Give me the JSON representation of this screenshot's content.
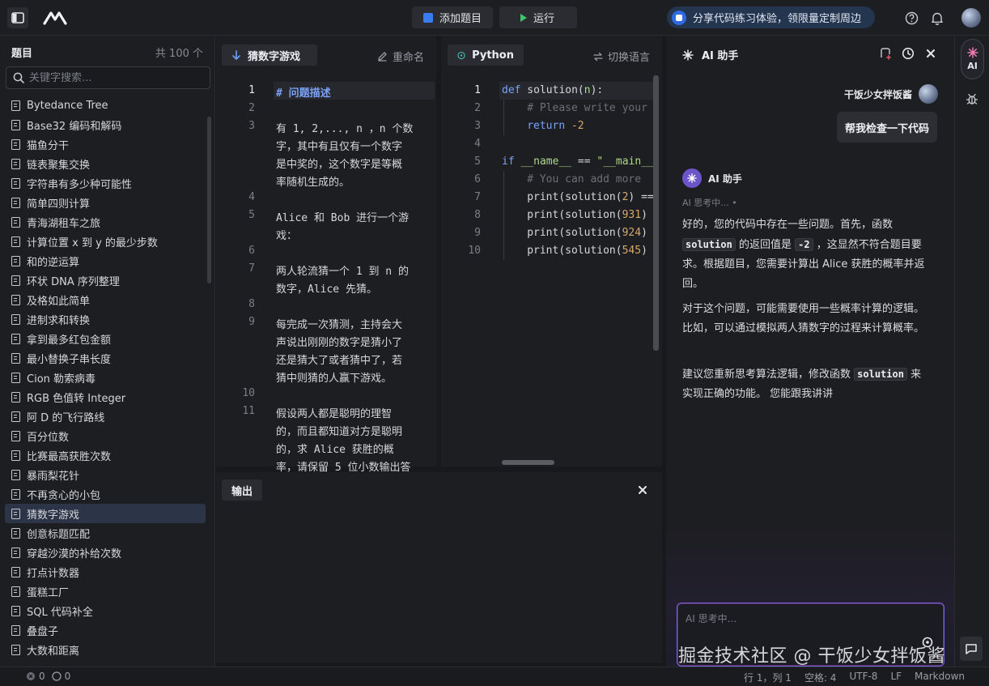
{
  "topbar": {
    "add_problem": "添加题目",
    "run": "运行",
    "share_banner": "分享代码练习体验，领限量定制周边"
  },
  "sidebar": {
    "title": "题目",
    "count": "共 100 个",
    "search_placeholder": "关键字搜索...",
    "items": [
      "Bytedance Tree",
      "Base32 编码和解码",
      "猫鱼分干",
      "链表聚集交换",
      "字符串有多少种可能性",
      "简单四则计算",
      "青海湖租车之旅",
      "计算位置 x 到 y 的最少步数",
      "和的逆运算",
      "环状 DNA 序列整理",
      "及格如此简单",
      "进制求和转换",
      "拿到最多红包金额",
      "最小替换子串长度",
      "Cion 勒索病毒",
      "RGB 色值转 Integer",
      "阿 D 的飞行路线",
      "百分位数",
      "比赛最高获胜次数",
      "暴雨梨花针",
      "不再贪心的小包",
      "猜数字游戏",
      "创意标题匹配",
      "穿越沙漠的补给次数",
      "打点计数器",
      "蛋糕工厂",
      "SQL 代码补全",
      "叠盘子",
      "大数和距离"
    ],
    "active_index": 21
  },
  "problem": {
    "tab": "猜数字游戏",
    "rename": "重命名",
    "line_numbers": [
      "1",
      "2",
      "3",
      "4",
      "5",
      "6",
      "7",
      "8",
      "9",
      "10",
      "11"
    ],
    "lines": [
      "# 问题描述",
      "有 1, 2,..., n ，n 个数",
      "字，其中有且仅有一个数字",
      "是中奖的，这个数字是等概",
      "率随机生成的。",
      "Alice 和 Bob 进行一个游",
      "戏：",
      "两人轮流猜一个 1 到 n 的",
      "数字，Alice 先猜。",
      "每完成一次猜测，主持会大",
      "声说出刚刚的数字是猜小了",
      "还是猜大了或者猜中了，若",
      "猜中则猜的人赢下游戏。",
      "假设两人都是聪明的理智",
      "的，而且都知道对方是聪明",
      "的，求 Alice 获胜的概",
      "率，请保留 5 位小数输出答"
    ]
  },
  "editor": {
    "language_tab": "Python",
    "switch_language": "切换语言",
    "line_numbers": [
      "1",
      "2",
      "3",
      "4",
      "5",
      "6",
      "7",
      "8",
      "9",
      "10"
    ],
    "code": {
      "l1_kw": "def",
      "l1_fn": " solution(",
      "l1_arg": "n",
      "l1_end": "):",
      "l2": "# Please write your",
      "l3_kw": "return",
      "l3_num": " -2",
      "l5_kw": "if",
      "l5_name": " __name__",
      "l5_op": " == ",
      "l5_str": "\"__main__",
      "l6": "#  You can add more",
      "l7_fn": "print(solution(",
      "l7_num": "2",
      "l7_end": ") ==",
      "l8_fn": "print(solution(",
      "l8_num": "931",
      "l8_end": ")",
      "l9_fn": "print(solution(",
      "l9_num": "924",
      "l9_end": ")",
      "l10_fn": "print(solution(",
      "l10_num": "545",
      "l10_end": ")"
    }
  },
  "output": {
    "tab": "输出"
  },
  "ai": {
    "title": "AI 助手",
    "user_name": "干饭少女拌饭酱",
    "user_message": "帮我检查一下代码",
    "assistant_name": "AI 助手",
    "thinking": "AI 思考中... •",
    "p1_a": "好的，您的代码中存在一些问题。首先，函数",
    "p1_code1": "solution",
    "p1_b": "的返回值是",
    "p1_code2": "-2",
    "p1_c": "，这显然不符合题目要求。根据题目，您需要计算出 Alice 获胜的概率并返回。",
    "p2": "对于这个问题，可能需要使用一些概率计算的逻辑。比如，可以通过模拟两人猜数字的过程来计算概率。",
    "p3_a": "建议您重新思考算法逻辑，修改函数",
    "p3_code": "solution",
    "p3_b": "来实现正确的功能。 您能跟我讲讲",
    "input_placeholder": "AI 思考中..."
  },
  "strip": {
    "ai_label": "AI"
  },
  "status": {
    "errors": "0",
    "warnings": "0",
    "position": "行 1，列 1",
    "indent": "空格: 4",
    "encoding": "UTF-8",
    "eol": "LF",
    "mode": "Markdown"
  },
  "watermark": "掘金技术社区 @ 干饭少女拌饭酱",
  "colors": {
    "accent": "#2f6ae6",
    "ai_purple": "#7a63e6",
    "active_item": "#2c3447"
  }
}
